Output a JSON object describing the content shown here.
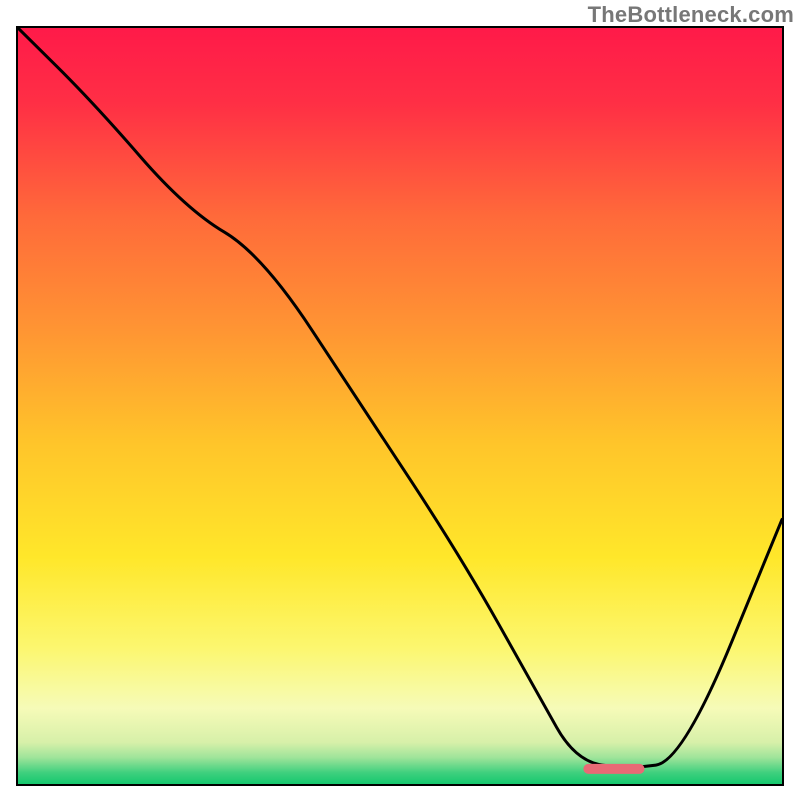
{
  "watermark": "TheBottleneck.com",
  "chart_data": {
    "type": "line",
    "title": "",
    "xlabel": "",
    "ylabel": "",
    "xlim": [
      0,
      100
    ],
    "ylim": [
      0,
      100
    ],
    "grid": false,
    "legend": false,
    "annotations": [],
    "background": {
      "type": "vertical-gradient",
      "stops": [
        {
          "pos": 0.0,
          "color": "#ff1a49"
        },
        {
          "pos": 0.1,
          "color": "#ff2f45"
        },
        {
          "pos": 0.25,
          "color": "#ff6a3a"
        },
        {
          "pos": 0.4,
          "color": "#ff9533"
        },
        {
          "pos": 0.55,
          "color": "#ffc52a"
        },
        {
          "pos": 0.7,
          "color": "#ffe72a"
        },
        {
          "pos": 0.82,
          "color": "#fcf76f"
        },
        {
          "pos": 0.9,
          "color": "#f6fbb8"
        },
        {
          "pos": 0.945,
          "color": "#d7f0a9"
        },
        {
          "pos": 0.965,
          "color": "#9fe49a"
        },
        {
          "pos": 0.985,
          "color": "#3fd07e"
        },
        {
          "pos": 1.0,
          "color": "#15c86e"
        }
      ]
    },
    "series": [
      {
        "name": "bottleneck-curve",
        "color": "#000000",
        "x": [
          0,
          10,
          22,
          32,
          45,
          58,
          68,
          73,
          80,
          87,
          100
        ],
        "y": [
          100,
          90,
          76,
          70,
          50,
          30,
          12,
          3,
          2,
          3,
          35
        ]
      }
    ],
    "marker": {
      "name": "optimal-range",
      "color": "#e86a75",
      "x_start": 74,
      "x_end": 82,
      "y": 2
    }
  }
}
